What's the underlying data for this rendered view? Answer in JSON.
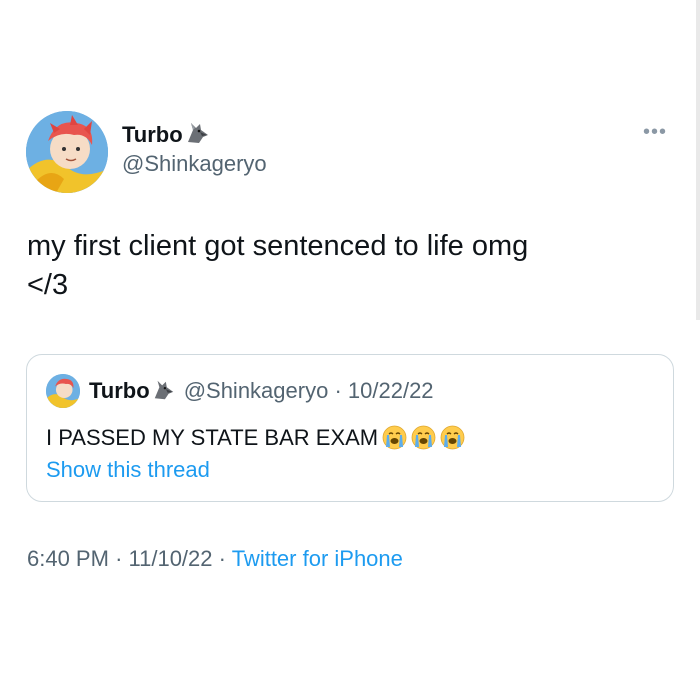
{
  "tweet": {
    "author_name": "Turbo",
    "handle": "@Shinkageryo",
    "more_label": "•••",
    "text_line1": "my first client got sentenced to life omg",
    "text_line2": "</3",
    "time": "6:40 PM",
    "date": "11/10/22",
    "source": "Twitter for iPhone",
    "separator": "·"
  },
  "quote": {
    "author_name": "Turbo",
    "handle": "@Shinkageryo",
    "separator": "·",
    "date": "10/22/22",
    "text": "I PASSED MY STATE BAR EXAM",
    "emoji_count": 3,
    "link": "Show this thread"
  },
  "icons": {
    "avatar": "anime-avatar",
    "name_emoji": "wolf-emoji",
    "quote_emoji": "loudly-crying-face-emoji",
    "more": "more-icon"
  },
  "colors": {
    "link": "#1d9bf0",
    "secondary_text": "#536471",
    "border": "#cfd9de"
  }
}
